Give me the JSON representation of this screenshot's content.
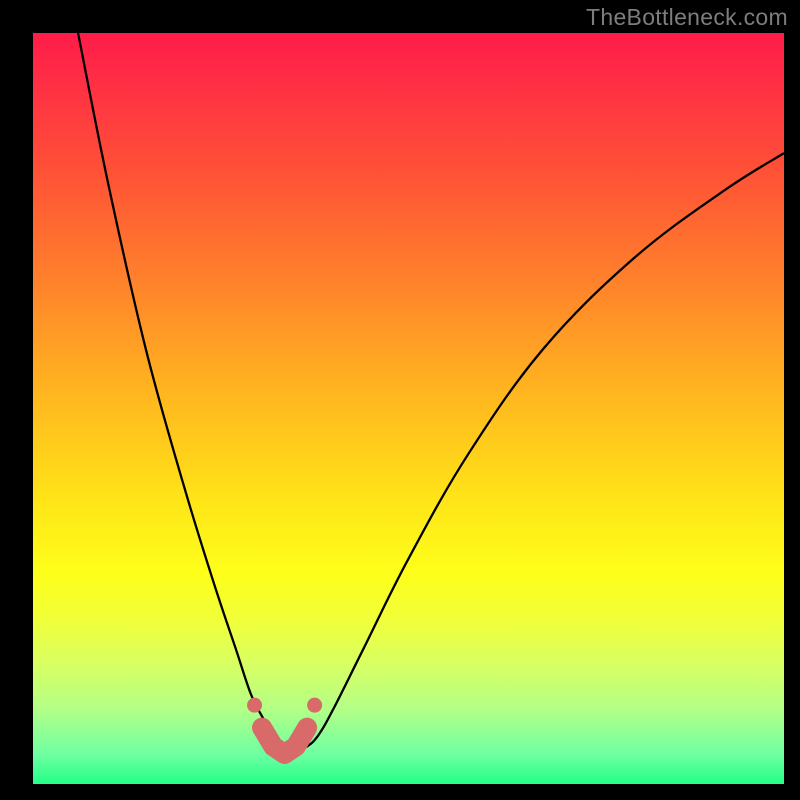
{
  "watermark": "TheBottleneck.com",
  "colors": {
    "frame": "#000000",
    "curve_stroke": "#000000",
    "marker_fill": "#d86a6a",
    "marker_stroke": "#c45353",
    "gradient_top": "#ff1c49",
    "gradient_bottom": "#23ff87"
  },
  "chart_data": {
    "type": "line",
    "title": "",
    "xlabel": "",
    "ylabel": "",
    "xlim": [
      0,
      100
    ],
    "ylim": [
      0,
      100
    ],
    "series": [
      {
        "name": "bottleneck-curve",
        "x": [
          6,
          10,
          15,
          20,
          24,
          27,
          29,
          30.5,
          32,
          33.5,
          35,
          36.5,
          38,
          40,
          44,
          50,
          58,
          68,
          80,
          92,
          100
        ],
        "y": [
          100,
          80,
          58,
          40,
          27,
          18,
          12,
          9,
          6.5,
          5,
          4.5,
          5,
          6.5,
          10,
          18,
          30,
          44,
          58,
          70,
          79,
          84
        ]
      }
    ],
    "markers": {
      "name": "highlight-segment",
      "x": [
        29.5,
        30.5,
        32,
        33.5,
        35,
        36.5,
        37.5
      ],
      "y": [
        10.5,
        7.5,
        5,
        4,
        5,
        7.5,
        10.5
      ]
    }
  }
}
